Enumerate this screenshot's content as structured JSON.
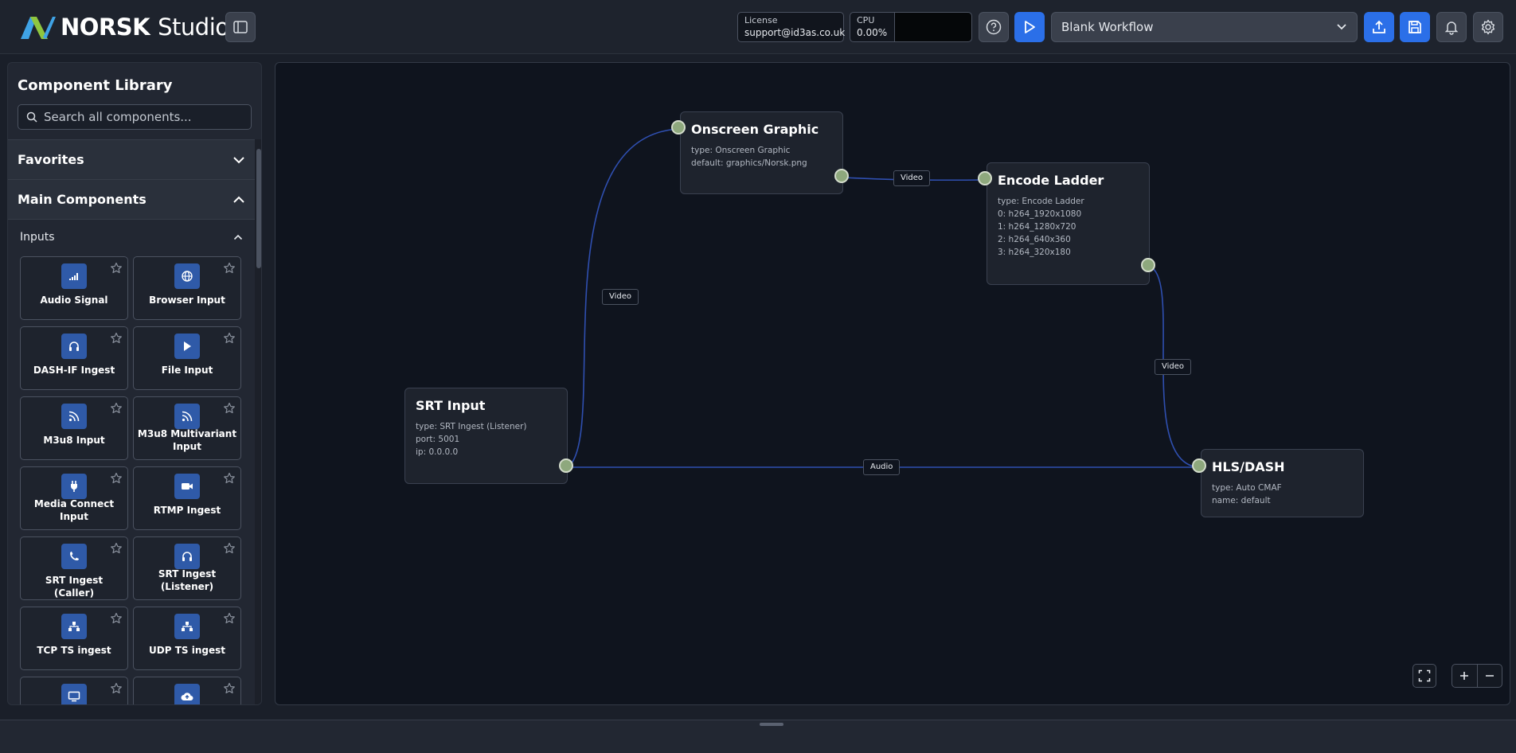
{
  "header": {
    "brand": "NORSK",
    "brand_suffix": "Studio",
    "license": {
      "label": "License",
      "value": "support@id3as.co.uk"
    },
    "cpu": {
      "label": "CPU",
      "value": "0.00%"
    },
    "workflow": {
      "selected": "Blank Workflow"
    },
    "colors": {
      "accent": "#2b6fe8",
      "logo_green": "#8fc63f",
      "logo_blue": "#3fa3e6"
    }
  },
  "sidebar": {
    "title": "Component Library",
    "search_placeholder": "Search all components...",
    "sections": [
      {
        "label": "Favorites",
        "expanded": false
      },
      {
        "label": "Main Components",
        "expanded": true
      }
    ],
    "subsection": {
      "label": "Inputs",
      "expanded": true
    },
    "components": [
      {
        "name": "Audio Signal",
        "icon": "signal-bars-icon"
      },
      {
        "name": "Browser Input",
        "icon": "globe-icon"
      },
      {
        "name": "DASH-IF Ingest",
        "icon": "headphones-icon"
      },
      {
        "name": "File Input",
        "icon": "play-icon"
      },
      {
        "name": "M3u8 Input",
        "icon": "rss-icon"
      },
      {
        "name": "M3u8 Multivariant Input",
        "icon": "rss-icon"
      },
      {
        "name": "Media Connect Input",
        "icon": "plug-icon"
      },
      {
        "name": "RTMP Ingest",
        "icon": "video-camera-icon"
      },
      {
        "name": "SRT Ingest (Caller)",
        "icon": "phone-icon"
      },
      {
        "name": "SRT Ingest (Listener)",
        "icon": "headset-icon"
      },
      {
        "name": "TCP TS ingest",
        "icon": "network-icon"
      },
      {
        "name": "UDP TS ingest",
        "icon": "network-icon"
      },
      {
        "name": "",
        "icon": "monitor-icon"
      },
      {
        "name": "",
        "icon": "cloud-upload-icon"
      }
    ]
  },
  "canvas": {
    "nodes": [
      {
        "id": "srt",
        "title": "SRT Input",
        "props": [
          "type: SRT Ingest (Listener)",
          "port: 5001",
          "ip: 0.0.0.0"
        ]
      },
      {
        "id": "og",
        "title": "Onscreen Graphic",
        "props": [
          "type: Onscreen Graphic",
          "default: graphics/Norsk.png"
        ]
      },
      {
        "id": "enc",
        "title": "Encode Ladder",
        "props": [
          "type: Encode Ladder",
          "0: h264_1920x1080",
          "1: h264_1280x720",
          "2: h264_640x360",
          "3: h264_320x180"
        ]
      },
      {
        "id": "hls",
        "title": "HLS/DASH",
        "props": [
          "type: Auto CMAF",
          "name: default"
        ]
      }
    ],
    "edges": [
      {
        "from": "srt",
        "to": "og",
        "label": "Video"
      },
      {
        "from": "og",
        "to": "enc",
        "label": "Video"
      },
      {
        "from": "enc",
        "to": "hls",
        "label": "Video"
      },
      {
        "from": "srt",
        "to": "hls",
        "label": "Audio"
      }
    ],
    "edge_color": "#2f4fb0",
    "port_color": "#8ea87d"
  }
}
